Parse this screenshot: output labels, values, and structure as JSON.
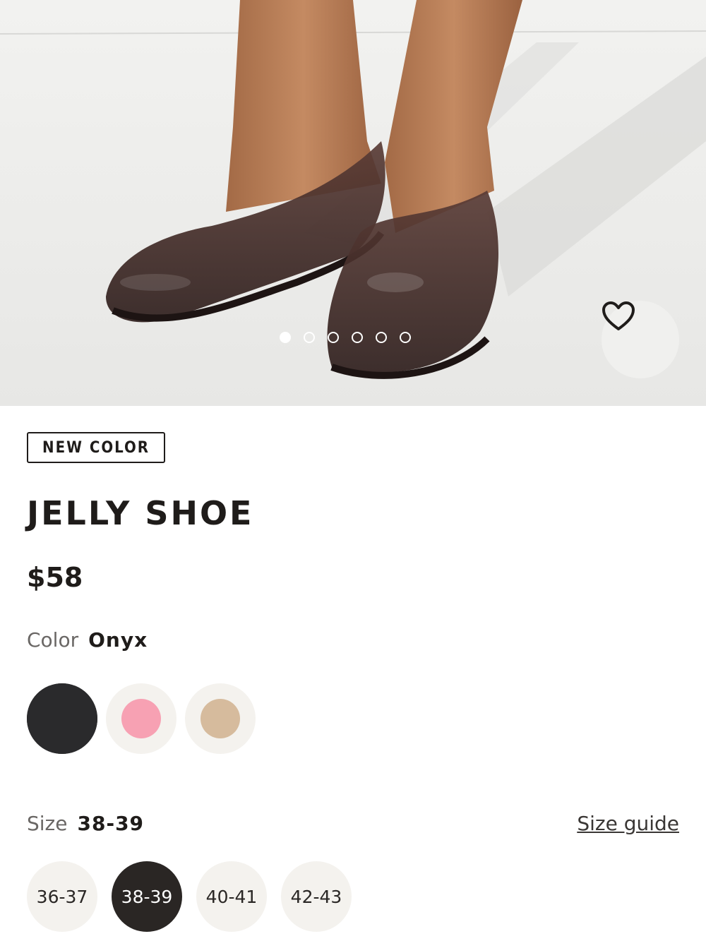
{
  "gallery": {
    "image_alt": "Model wearing translucent brown jelly flats",
    "dots_total": 6,
    "active_dot": 0,
    "favorite_icon": "heart-icon"
  },
  "product": {
    "badge": "NEW COLOR",
    "title": "JELLY SHOE",
    "price": "$58"
  },
  "color": {
    "label": "Color",
    "selected": "Onyx",
    "options": [
      {
        "name": "Onyx",
        "hex": "#2a2a2c"
      },
      {
        "name": "Pink",
        "hex": "#f7a1b3"
      },
      {
        "name": "Tan",
        "hex": "#d6bb9d"
      }
    ]
  },
  "size": {
    "label": "Size",
    "selected": "38-39",
    "guide_link": "Size guide",
    "options": [
      "36-37",
      "38-39",
      "40-41",
      "42-43"
    ]
  }
}
